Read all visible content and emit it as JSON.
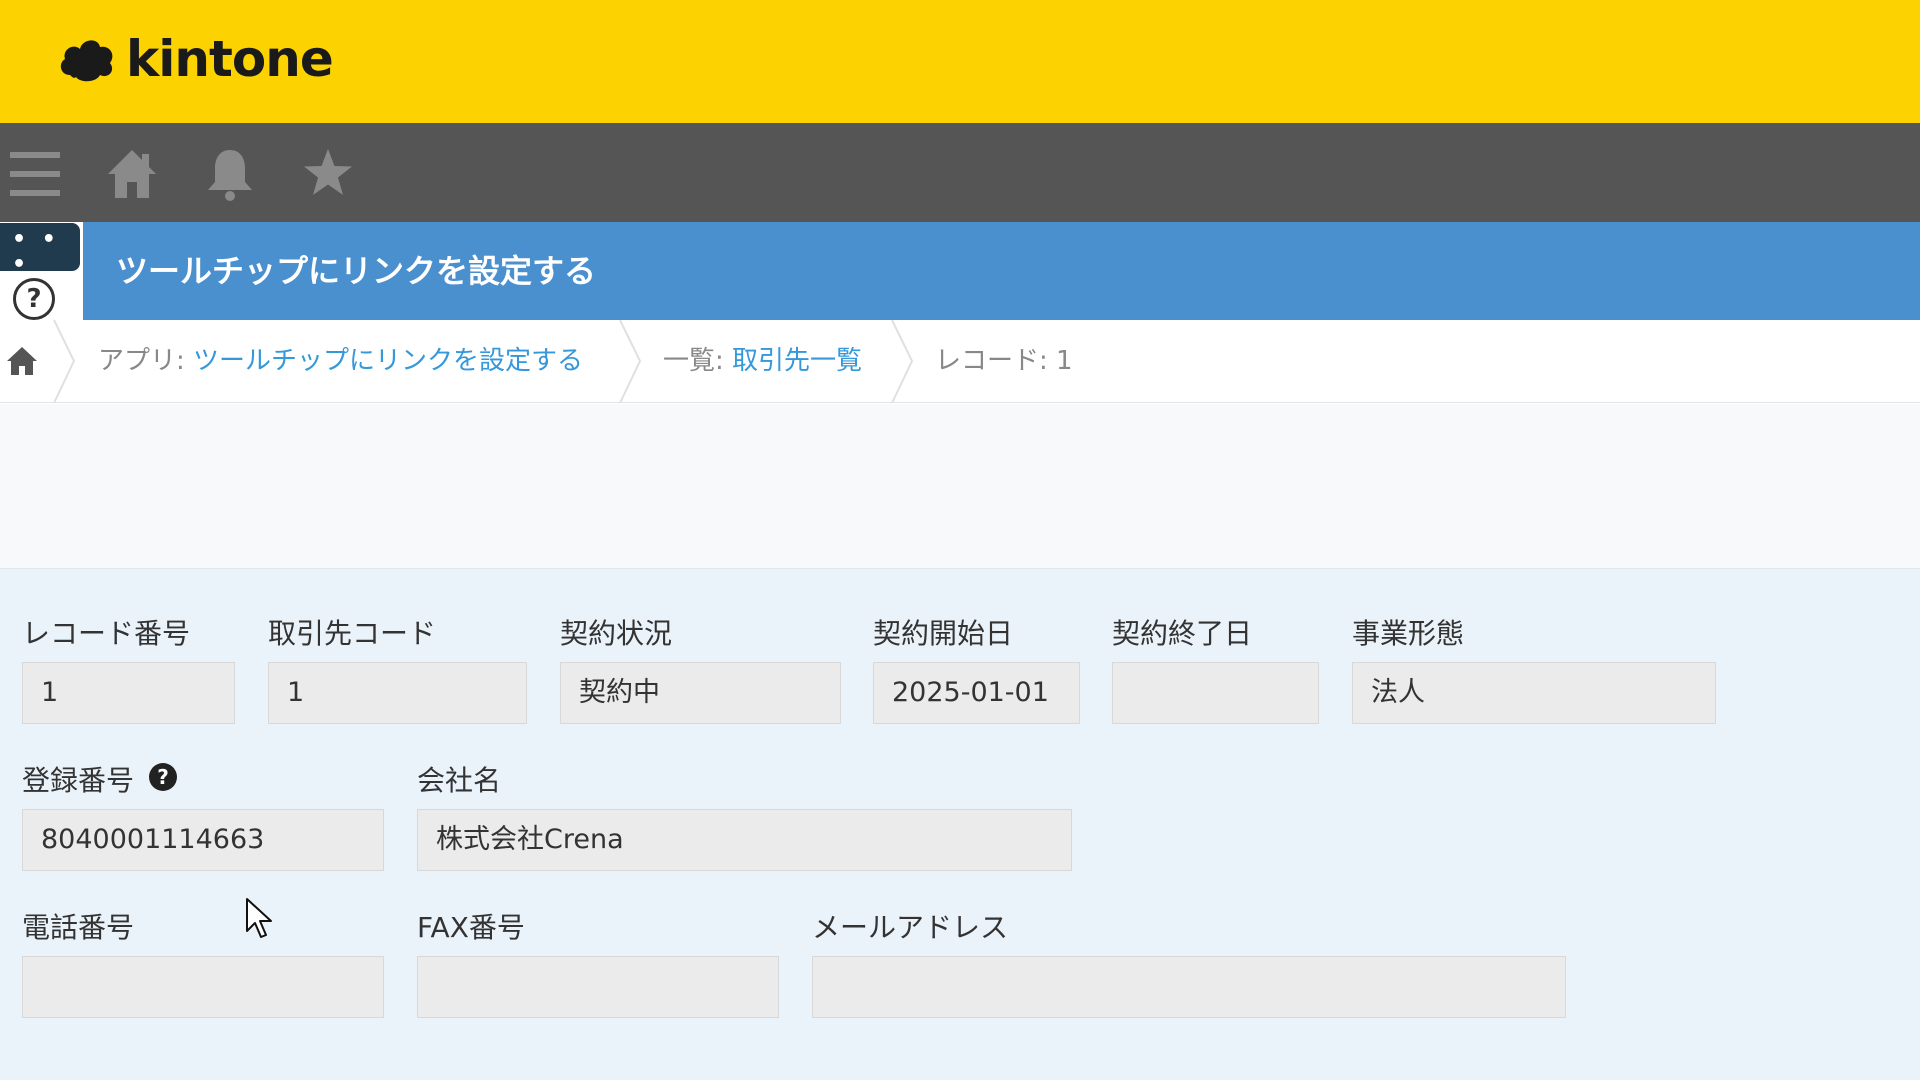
{
  "header": {
    "logo_text": "kintone",
    "bg_color": "#fcd200"
  },
  "nav": {
    "icons": [
      "menu-icon",
      "home-icon",
      "bell-icon",
      "star-icon"
    ]
  },
  "app": {
    "title": "ツールチップにリンクを設定する",
    "bar_color": "#4a8fce"
  },
  "side": {
    "more_label": "• • •",
    "help_label": "?"
  },
  "breadcrumb": {
    "app_prefix": "アプリ: ",
    "app_name": "ツールチップにリンクを設定する",
    "view_prefix": "一覧: ",
    "view_name": "取引先一覧",
    "record": "レコード: 1"
  },
  "form": {
    "record_number": {
      "label": "レコード番号",
      "value": "1"
    },
    "client_code": {
      "label": "取引先コード",
      "value": "1"
    },
    "contract_status": {
      "label": "契約状況",
      "value": "契約中"
    },
    "contract_start": {
      "label": "契約開始日",
      "value": "2025-01-01"
    },
    "contract_end": {
      "label": "契約終了日",
      "value": ""
    },
    "business_type": {
      "label": "事業形態",
      "value": "法人"
    },
    "registration_number": {
      "label": "登録番号",
      "value": "8040001114663",
      "help": "?"
    },
    "company_name": {
      "label": "会社名",
      "value": "株式会社Crena"
    },
    "phone": {
      "label": "電話番号",
      "value": ""
    },
    "fax": {
      "label": "FAX番号",
      "value": ""
    },
    "email": {
      "label": "メールアドレス",
      "value": ""
    }
  }
}
